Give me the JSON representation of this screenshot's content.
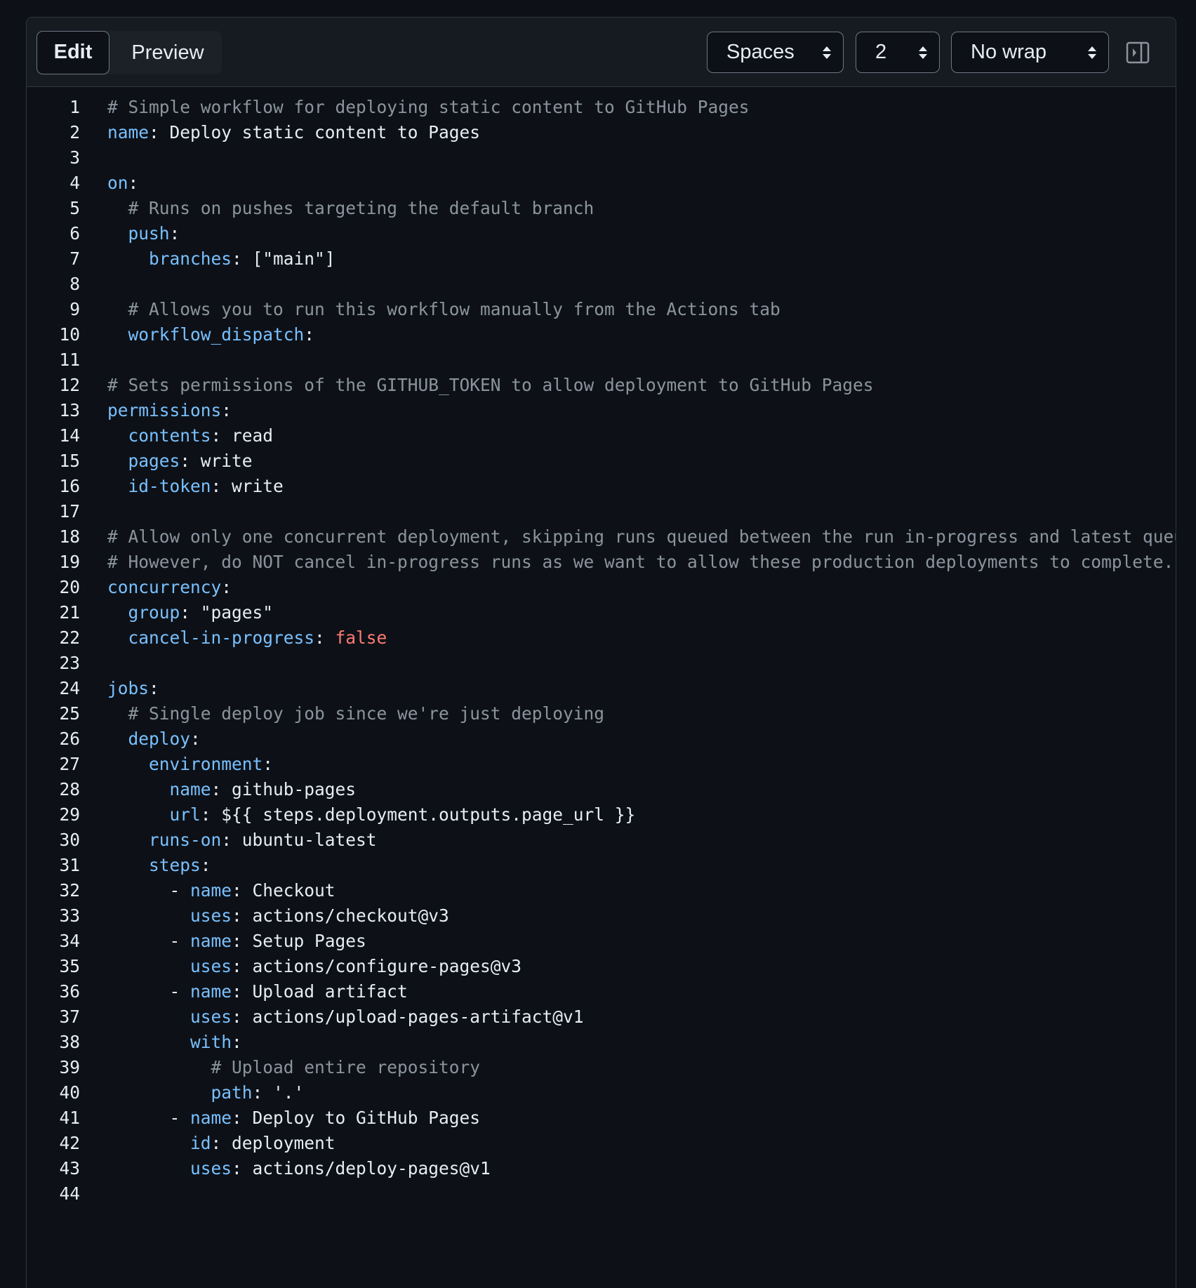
{
  "toolbar": {
    "tabs": {
      "edit": "Edit",
      "preview": "Preview"
    },
    "indent_mode": "Spaces",
    "indent_size": "2",
    "wrap_mode": "No wrap"
  },
  "colors": {
    "background": "#0d1117",
    "toolbar": "#161b22",
    "border": "#30363d",
    "comment": "#8b949e",
    "key": "#79c0ff",
    "text": "#e6edf3",
    "boolean": "#ff7b72"
  },
  "code": {
    "lines": [
      {
        "n": "1",
        "seg": [
          {
            "t": "# Simple workflow for deploying static content to GitHub Pages",
            "c": "c"
          }
        ]
      },
      {
        "n": "2",
        "seg": [
          {
            "t": "name",
            "c": "k"
          },
          {
            "t": ": Deploy static content to Pages",
            "c": "v"
          }
        ]
      },
      {
        "n": "3",
        "seg": []
      },
      {
        "n": "4",
        "seg": [
          {
            "t": "on",
            "c": "k"
          },
          {
            "t": ":",
            "c": "v"
          }
        ]
      },
      {
        "n": "5",
        "seg": [
          {
            "t": "  # Runs on pushes targeting the default branch",
            "c": "c"
          }
        ]
      },
      {
        "n": "6",
        "seg": [
          {
            "t": "  ",
            "c": "v"
          },
          {
            "t": "push",
            "c": "k"
          },
          {
            "t": ":",
            "c": "v"
          }
        ]
      },
      {
        "n": "7",
        "seg": [
          {
            "t": "    ",
            "c": "v"
          },
          {
            "t": "branches",
            "c": "k"
          },
          {
            "t": ": [\"main\"]",
            "c": "v"
          }
        ]
      },
      {
        "n": "8",
        "seg": []
      },
      {
        "n": "9",
        "seg": [
          {
            "t": "  # Allows you to run this workflow manually from the Actions tab",
            "c": "c"
          }
        ]
      },
      {
        "n": "10",
        "seg": [
          {
            "t": "  ",
            "c": "v"
          },
          {
            "t": "workflow_dispatch",
            "c": "k"
          },
          {
            "t": ":",
            "c": "v"
          }
        ]
      },
      {
        "n": "11",
        "seg": []
      },
      {
        "n": "12",
        "seg": [
          {
            "t": "# Sets permissions of the GITHUB_TOKEN to allow deployment to GitHub Pages",
            "c": "c"
          }
        ]
      },
      {
        "n": "13",
        "seg": [
          {
            "t": "permissions",
            "c": "k"
          },
          {
            "t": ":",
            "c": "v"
          }
        ]
      },
      {
        "n": "14",
        "seg": [
          {
            "t": "  ",
            "c": "v"
          },
          {
            "t": "contents",
            "c": "k"
          },
          {
            "t": ": read",
            "c": "v"
          }
        ]
      },
      {
        "n": "15",
        "seg": [
          {
            "t": "  ",
            "c": "v"
          },
          {
            "t": "pages",
            "c": "k"
          },
          {
            "t": ": write",
            "c": "v"
          }
        ]
      },
      {
        "n": "16",
        "seg": [
          {
            "t": "  ",
            "c": "v"
          },
          {
            "t": "id-token",
            "c": "k"
          },
          {
            "t": ": write",
            "c": "v"
          }
        ]
      },
      {
        "n": "17",
        "seg": []
      },
      {
        "n": "18",
        "seg": [
          {
            "t": "# Allow only one concurrent deployment, skipping runs queued between the run in-progress and latest queued.",
            "c": "c"
          }
        ]
      },
      {
        "n": "19",
        "seg": [
          {
            "t": "# However, do NOT cancel in-progress runs as we want to allow these production deployments to complete.",
            "c": "c"
          }
        ]
      },
      {
        "n": "20",
        "seg": [
          {
            "t": "concurrency",
            "c": "k"
          },
          {
            "t": ":",
            "c": "v"
          }
        ]
      },
      {
        "n": "21",
        "seg": [
          {
            "t": "  ",
            "c": "v"
          },
          {
            "t": "group",
            "c": "k"
          },
          {
            "t": ": \"pages\"",
            "c": "v"
          }
        ]
      },
      {
        "n": "22",
        "seg": [
          {
            "t": "  ",
            "c": "v"
          },
          {
            "t": "cancel-in-progress",
            "c": "k"
          },
          {
            "t": ": ",
            "c": "v"
          },
          {
            "t": "false",
            "c": "b"
          }
        ]
      },
      {
        "n": "23",
        "seg": []
      },
      {
        "n": "24",
        "seg": [
          {
            "t": "jobs",
            "c": "k"
          },
          {
            "t": ":",
            "c": "v"
          }
        ]
      },
      {
        "n": "25",
        "seg": [
          {
            "t": "  # Single deploy job since we're just deploying",
            "c": "c"
          }
        ]
      },
      {
        "n": "26",
        "seg": [
          {
            "t": "  ",
            "c": "v"
          },
          {
            "t": "deploy",
            "c": "k"
          },
          {
            "t": ":",
            "c": "v"
          }
        ]
      },
      {
        "n": "27",
        "seg": [
          {
            "t": "    ",
            "c": "v"
          },
          {
            "t": "environment",
            "c": "k"
          },
          {
            "t": ":",
            "c": "v"
          }
        ]
      },
      {
        "n": "28",
        "seg": [
          {
            "t": "      ",
            "c": "v"
          },
          {
            "t": "name",
            "c": "k"
          },
          {
            "t": ": github-pages",
            "c": "v"
          }
        ]
      },
      {
        "n": "29",
        "seg": [
          {
            "t": "      ",
            "c": "v"
          },
          {
            "t": "url",
            "c": "k"
          },
          {
            "t": ": ${{ steps.deployment.outputs.page_url }}",
            "c": "v"
          }
        ]
      },
      {
        "n": "30",
        "seg": [
          {
            "t": "    ",
            "c": "v"
          },
          {
            "t": "runs-on",
            "c": "k"
          },
          {
            "t": ": ubuntu-latest",
            "c": "v"
          }
        ]
      },
      {
        "n": "31",
        "seg": [
          {
            "t": "    ",
            "c": "v"
          },
          {
            "t": "steps",
            "c": "k"
          },
          {
            "t": ":",
            "c": "v"
          }
        ]
      },
      {
        "n": "32",
        "seg": [
          {
            "t": "      - ",
            "c": "v"
          },
          {
            "t": "name",
            "c": "k"
          },
          {
            "t": ": Checkout",
            "c": "v"
          }
        ]
      },
      {
        "n": "33",
        "seg": [
          {
            "t": "        ",
            "c": "v"
          },
          {
            "t": "uses",
            "c": "k"
          },
          {
            "t": ": actions/checkout@v3",
            "c": "v"
          }
        ]
      },
      {
        "n": "34",
        "seg": [
          {
            "t": "      - ",
            "c": "v"
          },
          {
            "t": "name",
            "c": "k"
          },
          {
            "t": ": Setup Pages",
            "c": "v"
          }
        ]
      },
      {
        "n": "35",
        "seg": [
          {
            "t": "        ",
            "c": "v"
          },
          {
            "t": "uses",
            "c": "k"
          },
          {
            "t": ": actions/configure-pages@v3",
            "c": "v"
          }
        ]
      },
      {
        "n": "36",
        "seg": [
          {
            "t": "      - ",
            "c": "v"
          },
          {
            "t": "name",
            "c": "k"
          },
          {
            "t": ": Upload artifact",
            "c": "v"
          }
        ]
      },
      {
        "n": "37",
        "seg": [
          {
            "t": "        ",
            "c": "v"
          },
          {
            "t": "uses",
            "c": "k"
          },
          {
            "t": ": actions/upload-pages-artifact@v1",
            "c": "v"
          }
        ]
      },
      {
        "n": "38",
        "seg": [
          {
            "t": "        ",
            "c": "v"
          },
          {
            "t": "with",
            "c": "k"
          },
          {
            "t": ":",
            "c": "v"
          }
        ]
      },
      {
        "n": "39",
        "seg": [
          {
            "t": "          # Upload entire repository",
            "c": "c"
          }
        ]
      },
      {
        "n": "40",
        "seg": [
          {
            "t": "          ",
            "c": "v"
          },
          {
            "t": "path",
            "c": "k"
          },
          {
            "t": ": '.'",
            "c": "v"
          }
        ]
      },
      {
        "n": "41",
        "seg": [
          {
            "t": "      - ",
            "c": "v"
          },
          {
            "t": "name",
            "c": "k"
          },
          {
            "t": ": Deploy to GitHub Pages",
            "c": "v"
          }
        ]
      },
      {
        "n": "42",
        "seg": [
          {
            "t": "        ",
            "c": "v"
          },
          {
            "t": "id",
            "c": "k"
          },
          {
            "t": ": deployment",
            "c": "v"
          }
        ]
      },
      {
        "n": "43",
        "seg": [
          {
            "t": "        ",
            "c": "v"
          },
          {
            "t": "uses",
            "c": "k"
          },
          {
            "t": ": actions/deploy-pages@v1",
            "c": "v"
          }
        ]
      },
      {
        "n": "44",
        "seg": []
      }
    ]
  }
}
